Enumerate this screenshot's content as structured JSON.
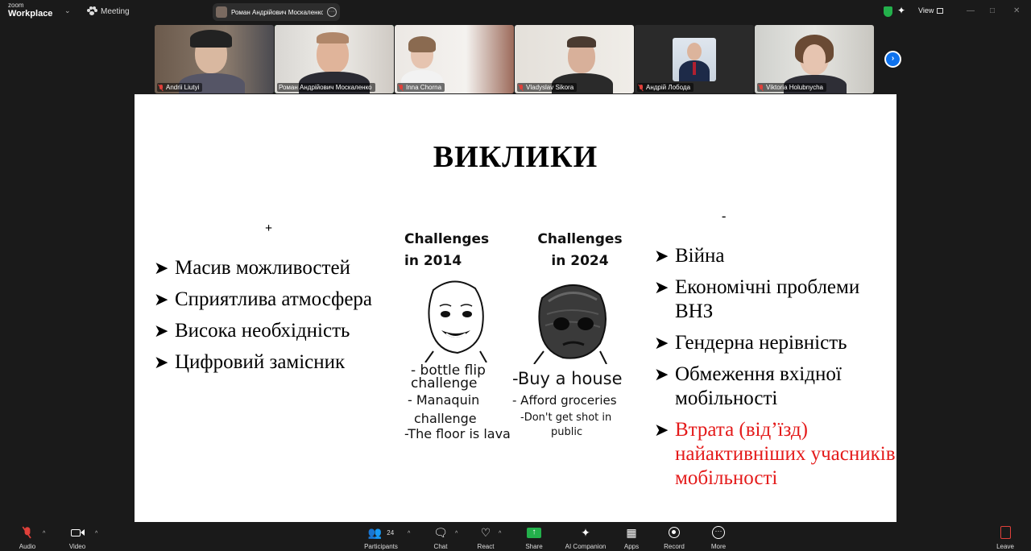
{
  "app": {
    "logo_line1": "zoom",
    "logo_line2": "Workplace",
    "meeting_label": "Meeting",
    "active_speaker": "Роман Андрійович Москаленко",
    "view_label": "View"
  },
  "participants_strip": [
    {
      "name": "Andrii Liutyi",
      "muted": true,
      "active": false
    },
    {
      "name": "Роман Андрійович Москаленко",
      "muted": false,
      "active": true
    },
    {
      "name": "Inna Chorna",
      "muted": true,
      "active": false
    },
    {
      "name": "Vladyslav Sikora",
      "muted": true,
      "active": false
    },
    {
      "name": "Андрій Лобода",
      "muted": true,
      "active": false
    },
    {
      "name": "Viktoria Holubnycha",
      "muted": true,
      "active": false
    }
  ],
  "slide": {
    "title": "ВИКЛИКИ",
    "plus_sign": "+",
    "minus_sign": "-",
    "left_list": [
      "Масив можливостей",
      "Сприятлива атмосфера",
      "Висока необхідність",
      "Цифровий замісник"
    ],
    "right_list": [
      "Війна",
      "Економічні проблеми ВНЗ",
      "Гендерна нерівність",
      "Обмеження вхідної мобільності",
      "Втрата (від’їзд) найактивніших учасників мобільності"
    ],
    "highlight_color": "#e41a1a",
    "meme": {
      "left_header_1": "Challenges",
      "left_header_2": "in 2014",
      "right_header_1": "Challenges",
      "right_header_2": "in 2024",
      "left_items": [
        "- bottle flip",
        "challenge",
        "- Manaquin",
        "challenge",
        "-The floor is lava"
      ],
      "right_items": [
        "-Buy a house",
        "- Afford groceries",
        "-Don't get shot in",
        "public"
      ]
    }
  },
  "toolbar": {
    "audio": "Audio",
    "video": "Video",
    "participants": "Participants",
    "participants_count": "24",
    "chat": "Chat",
    "react": "React",
    "share": "Share",
    "ai_companion": "AI Companion",
    "apps": "Apps",
    "record": "Record",
    "more": "More",
    "leave": "Leave"
  }
}
